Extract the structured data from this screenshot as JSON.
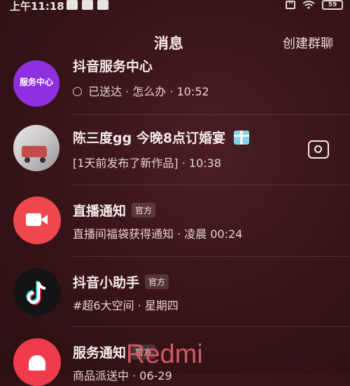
{
  "status": {
    "time": "上午11:18",
    "battery": "59"
  },
  "header": {
    "title": "消息",
    "action": "创建群聊"
  },
  "conversations": [
    {
      "name": "抖音服务中心",
      "sub": "已送达 · 怎么办 · 10:52",
      "avatar_text": "服务中心"
    },
    {
      "name": "陈三度gg 今晚8点订婚宴",
      "sub": "[1天前发布了新作品] · 10:38"
    },
    {
      "name": "直播通知",
      "badge": "官方",
      "sub": "直播间福袋获得通知 · 凌晨 00:24"
    },
    {
      "name": "抖音小助手",
      "badge": "官方",
      "sub": "#超6大空间 · 星期四"
    },
    {
      "name": "服务通知",
      "badge": "官方",
      "sub": "商品派送中 · 06-29"
    }
  ],
  "watermark": "Redmi",
  "colors": {
    "live_red": "#f0474f",
    "bell_red": "#ef3b4a",
    "tiktok_black": "#141414"
  }
}
